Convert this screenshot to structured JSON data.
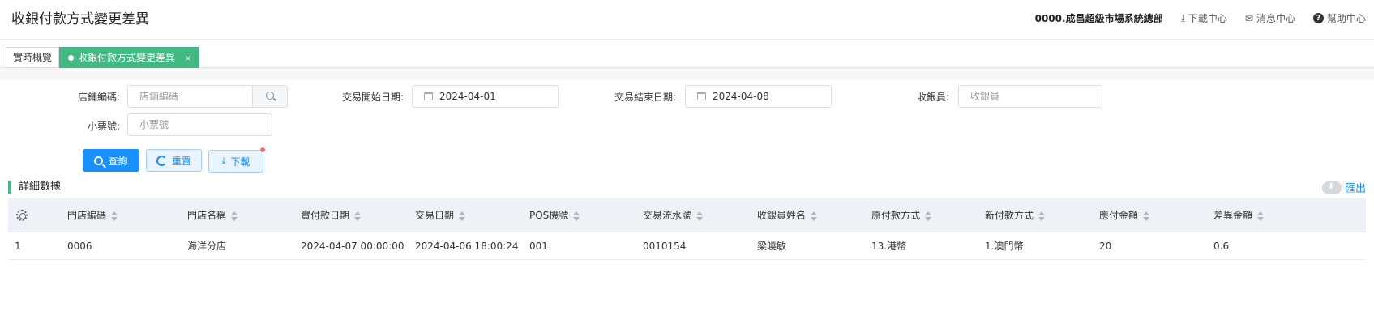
{
  "header": {
    "title": "收銀付款方式變更差異",
    "company": "0000.成昌超級市場系統總部",
    "download_center": "下載中心",
    "message_center": "消息中心",
    "help_center": "幫助中心"
  },
  "tabs": [
    {
      "label": "實時概覽"
    },
    {
      "label": "收銀付款方式變更差異",
      "close": "×"
    }
  ],
  "filters": {
    "store_code": {
      "label": "店鋪編碼:",
      "placeholder": "店鋪編碼"
    },
    "start_date": {
      "label": "交易開始日期:",
      "value": "2024-04-01"
    },
    "end_date": {
      "label": "交易結束日期:",
      "value": "2024-04-08"
    },
    "cashier": {
      "label": "收銀員:",
      "placeholder": "收銀員"
    },
    "receipt_no": {
      "label": "小票號:",
      "placeholder": "小票號"
    }
  },
  "actions": {
    "query": "查詢",
    "reset": "重置",
    "download": "下載"
  },
  "section": {
    "title": "詳細數據",
    "export": "匯出"
  },
  "table": {
    "columns": [
      "門店編碼",
      "門店名稱",
      "實付款日期",
      "交易日期",
      "POS機號",
      "交易流水號",
      "收銀員姓名",
      "原付款方式",
      "新付款方式",
      "應付金額",
      "差異金額"
    ],
    "rows": [
      {
        "index": "1",
        "cells": [
          "0006",
          "海洋分店",
          "2024-04-07 00:00:00",
          "2024-04-06 18:00:24",
          "001",
          "0010154",
          "梁曉敏",
          "13.港幣",
          "1.澳門幣",
          "20",
          "0.6"
        ]
      }
    ]
  },
  "colors": {
    "accent_green": "#42b983",
    "primary_blue": "#1890ff",
    "badge_red": "#f56c6c"
  }
}
